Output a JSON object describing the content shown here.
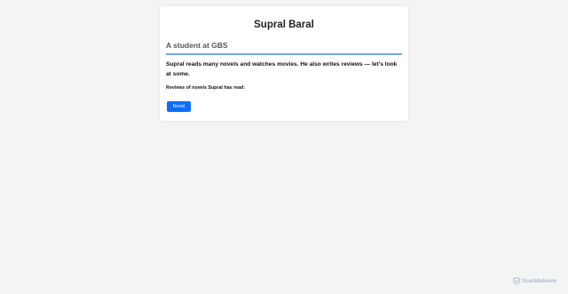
{
  "card": {
    "title": "Supral Baral",
    "subtitle": "A student at GBS",
    "intro": "Supral reads many novels and watches movies. He also writes reviews — let's look at some.",
    "reviews_label": "Reviews of novels Supral has read:",
    "button_label": "Novel"
  },
  "watermark": {
    "text": "ScanMalware",
    "icon": "shield-icon"
  },
  "colors": {
    "background": "#f4f4f4",
    "accent": "#0d6efd",
    "divider": "#6ea8e6"
  }
}
